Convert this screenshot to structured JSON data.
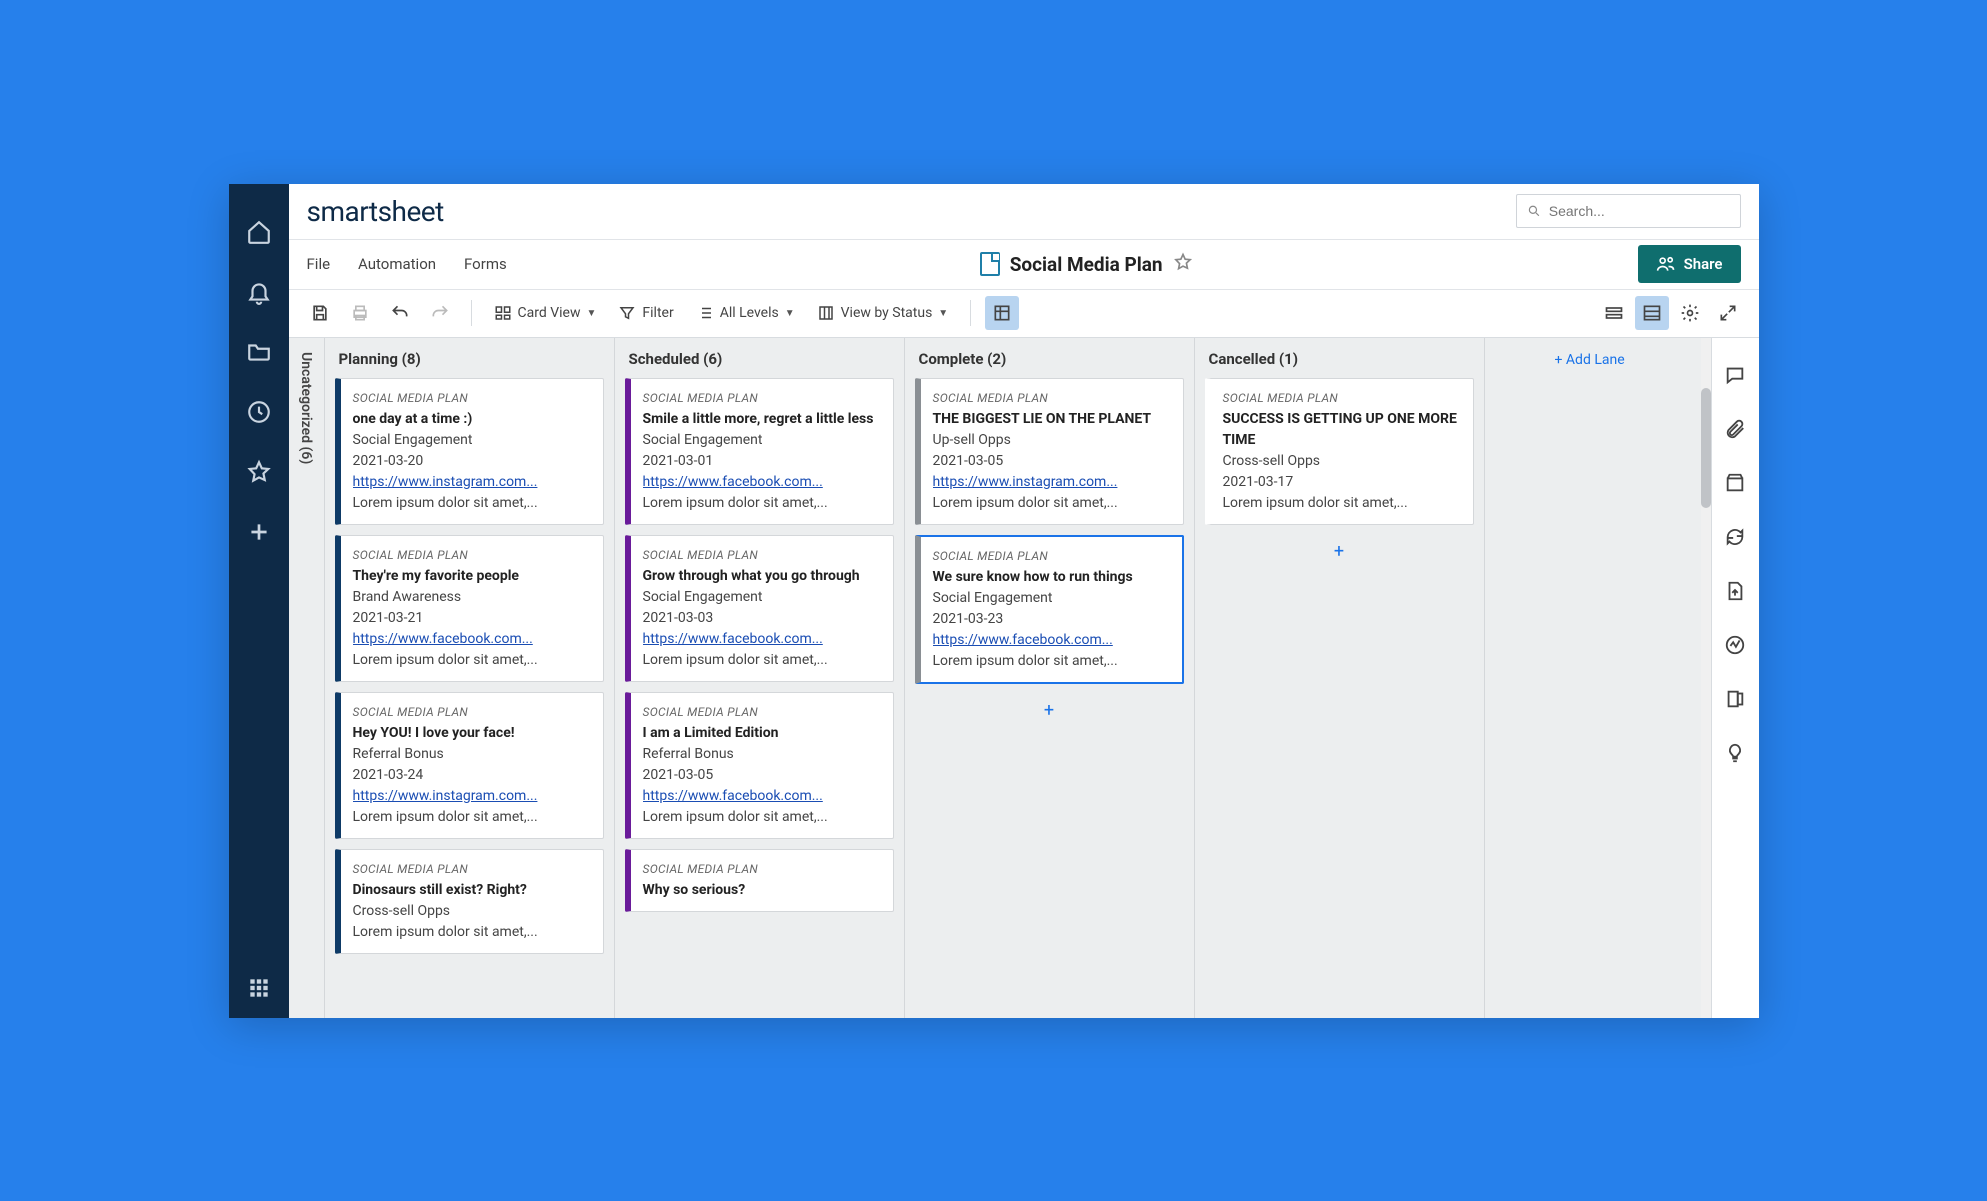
{
  "brand": "smartsheet",
  "search_placeholder": "Search...",
  "menus": {
    "file": "File",
    "automation": "Automation",
    "forms": "Forms"
  },
  "sheet_title": "Social Media Plan",
  "share_label": "Share",
  "toolbar": {
    "card_view": "Card View",
    "filter": "Filter",
    "all_levels": "All Levels",
    "view_by": "View by Status"
  },
  "vertical_lane": "Uncategorized (6)",
  "add_lane": "+ Add Lane",
  "plan_label": "SOCIAL MEDIA PLAN",
  "lorem": "Lorem ipsum dolor sit amet,...",
  "lanes": [
    {
      "title": "Planning (8)",
      "stripe": "#0e3a66",
      "cards": [
        {
          "title": "one day at a time :)",
          "category": "Social Engagement",
          "date": "2021-03-20",
          "link": "https://www.instagram.com..."
        },
        {
          "title": "They're my favorite people",
          "category": "Brand Awareness",
          "date": "2021-03-21",
          "link": "https://www.facebook.com..."
        },
        {
          "title": "Hey YOU! I love your face!",
          "category": "Referral Bonus",
          "date": "2021-03-24",
          "link": "https://www.instagram.com..."
        },
        {
          "title": "Dinosaurs still exist? Right?",
          "category": "Cross-sell Opps",
          "date": "",
          "link": ""
        }
      ]
    },
    {
      "title": "Scheduled (6)",
      "stripe": "#6a1b9a",
      "cards": [
        {
          "title": "Smile a little more, regret a little less",
          "category": "Social Engagement",
          "date": "2021-03-01",
          "link": "https://www.facebook.com..."
        },
        {
          "title": "Grow through what you go through",
          "category": "Social Engagement",
          "date": "2021-03-03",
          "link": "https://www.facebook.com..."
        },
        {
          "title": "I am a Limited Edition",
          "category": "Referral Bonus",
          "date": "2021-03-05",
          "link": "https://www.facebook.com..."
        },
        {
          "title": "Why so serious?",
          "category": "",
          "date": "",
          "link": ""
        }
      ]
    },
    {
      "title": "Complete (2)",
      "stripe": "#8a8f94",
      "cards": [
        {
          "title": "THE BIGGEST LIE ON THE PLANET",
          "category": "Up-sell Opps",
          "date": "2021-03-05",
          "link": "https://www.instagram.com..."
        },
        {
          "title": "We sure know how to run things",
          "category": "Social Engagement",
          "date": "2021-03-23",
          "link": "https://www.facebook.com...",
          "selected": true
        }
      ],
      "show_add": true
    },
    {
      "title": "Cancelled (1)",
      "stripe": "#ffffff",
      "cards": [
        {
          "title": "SUCCESS IS GETTING UP ONE MORE TIME",
          "category": "Cross-sell Opps",
          "date": "2021-03-17",
          "link": ""
        }
      ],
      "show_add": true
    }
  ]
}
